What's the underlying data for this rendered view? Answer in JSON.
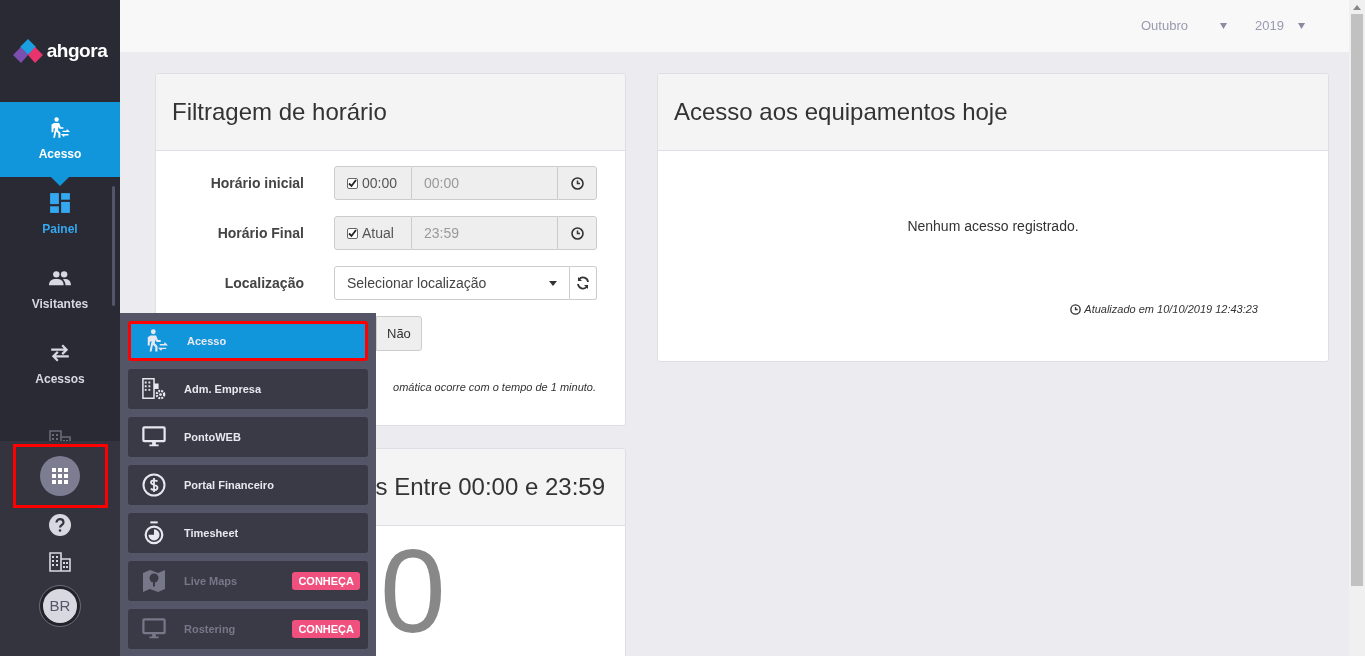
{
  "brand": {
    "name": "ahgora"
  },
  "sidebar": {
    "items": [
      {
        "label": "Acesso",
        "selected": true,
        "highlighted": false
      },
      {
        "label": "Painel",
        "selected": false,
        "highlighted": true
      },
      {
        "label": "Visitantes",
        "selected": false,
        "highlighted": false
      },
      {
        "label": "Acessos",
        "selected": false,
        "highlighted": false
      }
    ],
    "apps_button": {
      "outlined": true
    },
    "avatar": "BR"
  },
  "apps_menu": {
    "items": [
      {
        "label": "Acesso",
        "selected": true,
        "outlined": true,
        "disabled": false
      },
      {
        "label": "Adm. Empresa",
        "selected": false,
        "outlined": false,
        "disabled": false
      },
      {
        "label": "PontoWEB",
        "selected": false,
        "outlined": false,
        "disabled": false
      },
      {
        "label": "Portal Financeiro",
        "selected": false,
        "outlined": false,
        "disabled": false
      },
      {
        "label": "Timesheet",
        "selected": false,
        "outlined": false,
        "disabled": false
      },
      {
        "label": "Live Maps",
        "selected": false,
        "outlined": false,
        "disabled": true,
        "badge": "CONHEÇA"
      },
      {
        "label": "Rostering",
        "selected": false,
        "outlined": false,
        "disabled": true,
        "badge": "CONHEÇA"
      }
    ]
  },
  "top_bar": {
    "month": "Outubro",
    "year": "2019"
  },
  "filter_card": {
    "title": "Filtragem de horário",
    "fields": [
      {
        "kind": "time",
        "label": "Horário inicial",
        "checkbox_label": "00:00",
        "checked": true,
        "value": "00:00"
      },
      {
        "kind": "time",
        "label": "Horário Final",
        "checkbox_label": "Atual",
        "checked": true,
        "value": "23:59"
      },
      {
        "kind": "select",
        "label": "Localização",
        "placeholder": "Selecionar localização"
      }
    ],
    "toggle_button": "Não",
    "note": "omática ocorre com o tempo de 1 minuto."
  },
  "count_card": {
    "title": "s Entre 00:00 e 23:59",
    "count": "0"
  },
  "access_card": {
    "title": "Acesso aos equipamentos hoje",
    "empty_message": "Nenhum acesso registrado.",
    "updated": "Atualizado em 10/10/2019 12:43:23"
  }
}
